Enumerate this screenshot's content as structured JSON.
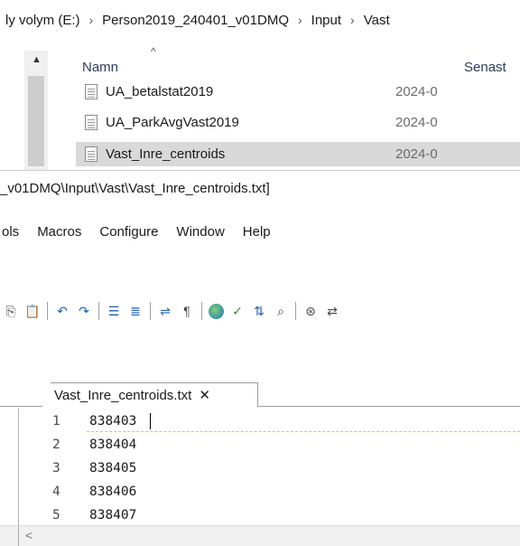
{
  "explorer": {
    "breadcrumb": [
      "ly volym (E:)",
      "Person2019_240401_v01DMQ",
      "Input",
      "Vast"
    ],
    "columns": {
      "name": "Namn",
      "modified": "Senast"
    },
    "files": [
      {
        "name": "UA_betalstat2019",
        "date": "2024-0",
        "selected": false
      },
      {
        "name": "UA_ParkAvgVast2019",
        "date": "2024-0",
        "selected": false
      },
      {
        "name": "Vast_Inre_centroids",
        "date": "2024-0",
        "selected": true
      }
    ]
  },
  "editor": {
    "title_path": "_v01DMQ\\Input\\Vast\\Vast_Inre_centroids.txt]",
    "menu": [
      "ols",
      "Macros",
      "Configure",
      "Window",
      "Help"
    ],
    "toolbar_icons": [
      "copy-icon",
      "paste-icon",
      "undo-icon",
      "redo-icon",
      "indent-icon",
      "outdent-icon",
      "wrap-icon",
      "pilcrow-icon",
      "globe-icon",
      "spellcheck-icon",
      "sort-icon",
      "find-files-icon",
      "find-icon",
      "replace-icon"
    ],
    "tab": {
      "label": "Vast_Inre_centroids.txt",
      "close": "✕"
    },
    "lines": [
      {
        "num": "1",
        "text": "838403"
      },
      {
        "num": "2",
        "text": "838404"
      },
      {
        "num": "3",
        "text": "838405"
      },
      {
        "num": "4",
        "text": "838406"
      },
      {
        "num": "5",
        "text": "838407"
      }
    ],
    "scroll_left": "<"
  }
}
